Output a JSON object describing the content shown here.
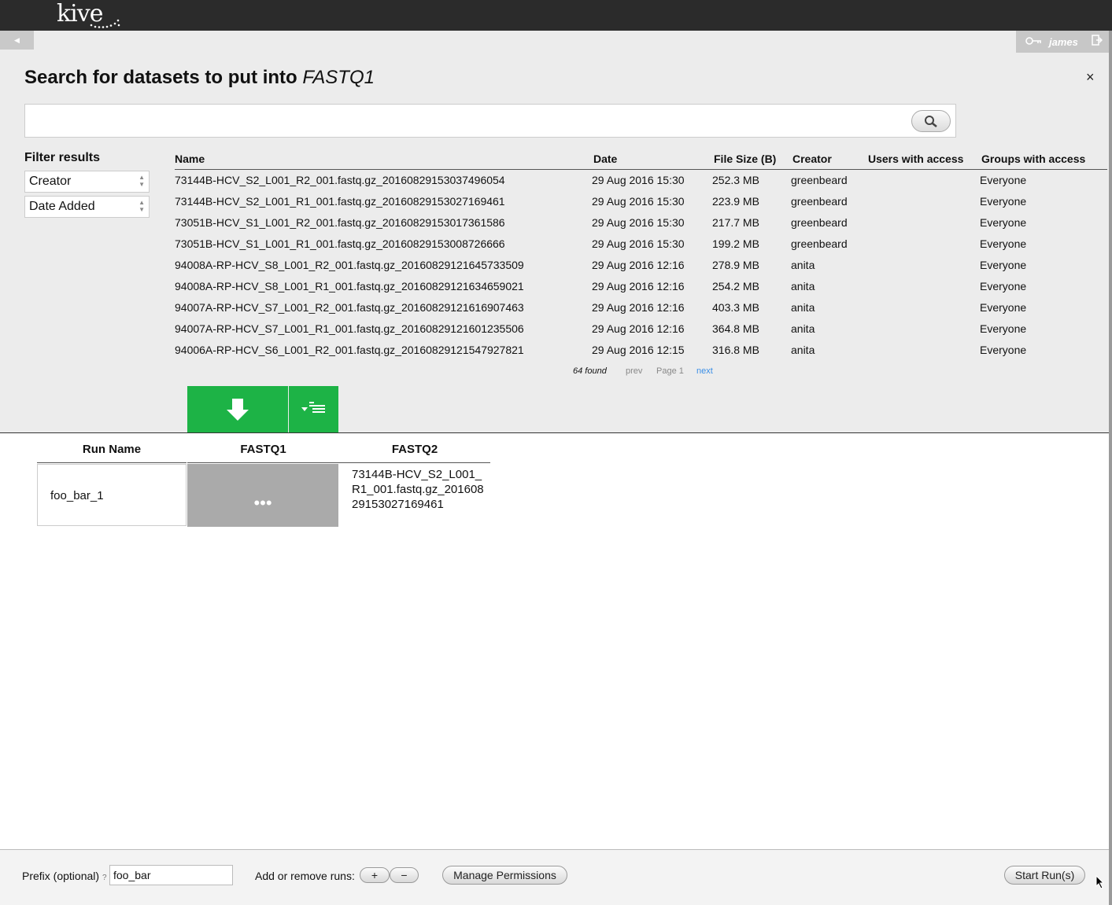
{
  "header": {
    "logo": "kive"
  },
  "user": {
    "name": "james"
  },
  "dialog": {
    "title_prefix": "Search for datasets to put into ",
    "title_input": "FASTQ1",
    "close": "×",
    "search_value": ""
  },
  "filter": {
    "title": "Filter results",
    "options": [
      "Creator",
      "Date Added"
    ]
  },
  "table": {
    "columns": [
      "Name",
      "Date",
      "File Size (B)",
      "Creator",
      "Users with access",
      "Groups with access"
    ],
    "rows": [
      [
        "73144B-HCV_S2_L001_R2_001.fastq.gz_20160829153037496054",
        "29 Aug 2016 15:30",
        "252.3 MB",
        "greenbeard",
        "",
        "Everyone"
      ],
      [
        "73144B-HCV_S2_L001_R1_001.fastq.gz_20160829153027169461",
        "29 Aug 2016 15:30",
        "223.9 MB",
        "greenbeard",
        "",
        "Everyone"
      ],
      [
        "73051B-HCV_S1_L001_R2_001.fastq.gz_20160829153017361586",
        "29 Aug 2016 15:30",
        "217.7 MB",
        "greenbeard",
        "",
        "Everyone"
      ],
      [
        "73051B-HCV_S1_L001_R1_001.fastq.gz_20160829153008726666",
        "29 Aug 2016 15:30",
        "199.2 MB",
        "greenbeard",
        "",
        "Everyone"
      ],
      [
        "94008A-RP-HCV_S8_L001_R2_001.fastq.gz_20160829121645733509",
        "29 Aug 2016 12:16",
        "278.9 MB",
        "anita",
        "",
        "Everyone"
      ],
      [
        "94008A-RP-HCV_S8_L001_R1_001.fastq.gz_20160829121634659021",
        "29 Aug 2016 12:16",
        "254.2 MB",
        "anita",
        "",
        "Everyone"
      ],
      [
        "94007A-RP-HCV_S7_L001_R2_001.fastq.gz_20160829121616907463",
        "29 Aug 2016 12:16",
        "403.3 MB",
        "anita",
        "",
        "Everyone"
      ],
      [
        "94007A-RP-HCV_S7_L001_R1_001.fastq.gz_20160829121601235506",
        "29 Aug 2016 12:16",
        "364.8 MB",
        "anita",
        "",
        "Everyone"
      ],
      [
        "94006A-RP-HCV_S6_L001_R2_001.fastq.gz_20160829121547927821",
        "29 Aug 2016 12:15",
        "316.8 MB",
        "anita",
        "",
        "Everyone"
      ]
    ]
  },
  "pager": {
    "found": "64 found",
    "prev": "prev",
    "page": "Page 1",
    "next": "next"
  },
  "runs": {
    "headers": [
      "Run Name",
      "FASTQ1",
      "FASTQ2"
    ],
    "row": {
      "name": "foo_bar_1",
      "fastq1": "•••",
      "fastq2": "73144B-HCV_S2_L001_R1_001.fastq.gz_20160829153027169461"
    }
  },
  "footer": {
    "prefix_label": "Prefix (optional)",
    "help": "?",
    "prefix_value": "foo_bar",
    "addremove_label": "Add or remove runs:",
    "plus": "+",
    "minus": "−",
    "permissions": "Manage Permissions",
    "start": "Start Run(s)"
  },
  "colors": {
    "topbar": "#2b2b2b",
    "panel": "#ececec",
    "green": "#1db346",
    "link": "#3a8ee6"
  }
}
